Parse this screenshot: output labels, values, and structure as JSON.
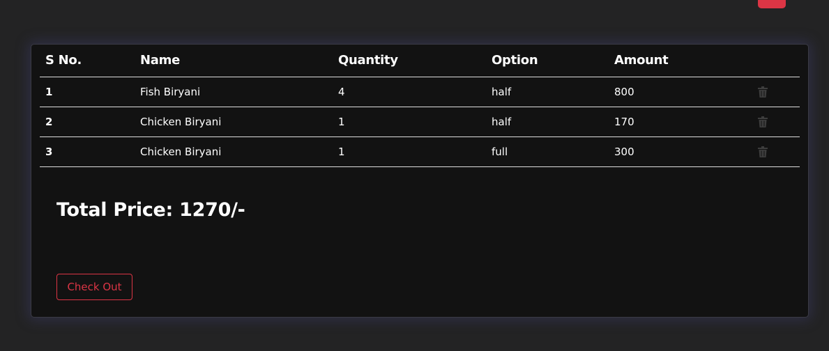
{
  "cart": {
    "columns": [
      "S No.",
      "Name",
      "Quantity",
      "Option",
      "Amount"
    ],
    "rows": [
      {
        "sno": "1",
        "name": "Fish Biryani",
        "quantity": "4",
        "option": "half",
        "amount": "800",
        "action_icon": "trash-icon"
      },
      {
        "sno": "2",
        "name": "Chicken Biryani",
        "quantity": "1",
        "option": "half",
        "amount": "170",
        "action_icon": "trash-icon"
      },
      {
        "sno": "3",
        "name": "Chicken Biryani",
        "quantity": "1",
        "option": "full",
        "amount": "300",
        "action_icon": "trash-icon"
      }
    ],
    "total_label": "Total Price: 1270/-",
    "checkout_label": "Check Out"
  },
  "colors": {
    "page_bg": "#232324",
    "card_bg": "#121212",
    "accent": "#dc3545",
    "icon_muted": "#3d3d3d"
  }
}
